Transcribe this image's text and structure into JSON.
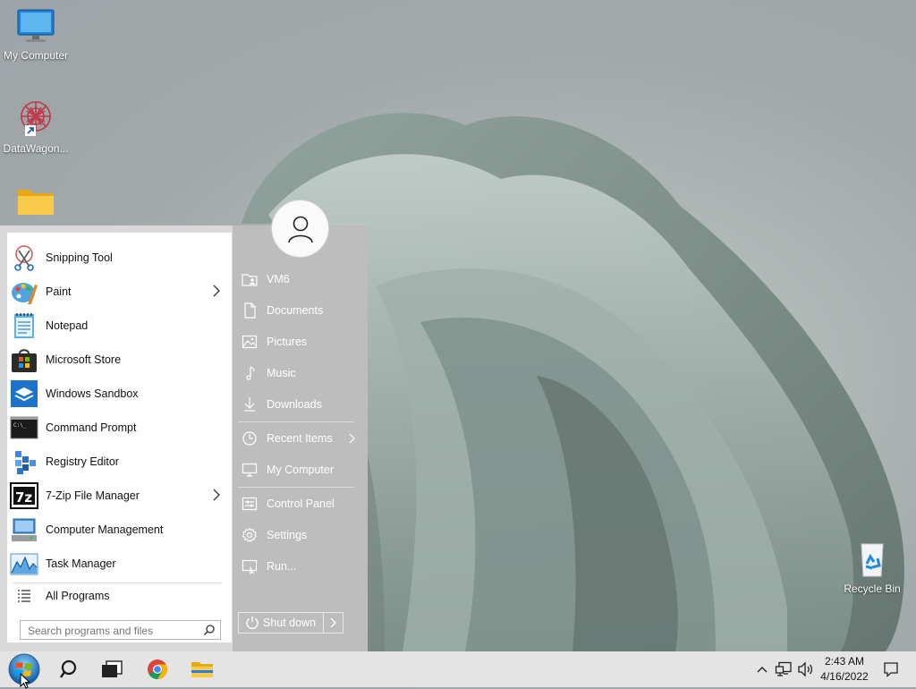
{
  "desktop": {
    "icons": [
      {
        "label": "My Computer",
        "icon": "monitor-icon"
      },
      {
        "label": "DataWagon...",
        "icon": "datawagon-icon"
      },
      {
        "label": "",
        "icon": "folder-icon"
      },
      {
        "label": "Recycle Bin",
        "icon": "recycle-bin-icon"
      }
    ]
  },
  "start_menu": {
    "programs": [
      {
        "label": "Snipping Tool",
        "icon": "snipping-tool-icon",
        "has_submenu": false
      },
      {
        "label": "Paint",
        "icon": "paint-icon",
        "has_submenu": true
      },
      {
        "label": "Notepad",
        "icon": "notepad-icon",
        "has_submenu": false
      },
      {
        "label": "Microsoft Store",
        "icon": "store-icon",
        "has_submenu": false
      },
      {
        "label": "Windows Sandbox",
        "icon": "sandbox-icon",
        "has_submenu": false
      },
      {
        "label": "Command Prompt",
        "icon": "cmd-icon",
        "has_submenu": false
      },
      {
        "label": "Registry Editor",
        "icon": "regedit-icon",
        "has_submenu": false
      },
      {
        "label": "7-Zip File Manager",
        "icon": "7zip-icon",
        "has_submenu": true
      },
      {
        "label": "Computer Management",
        "icon": "computer-management-icon",
        "has_submenu": false
      },
      {
        "label": "Task Manager",
        "icon": "task-manager-icon",
        "has_submenu": false
      }
    ],
    "all_programs": "All Programs",
    "search": {
      "placeholder": "Search programs and files",
      "value": ""
    },
    "places": [
      {
        "label": "VM6",
        "icon": "user-folder-icon"
      },
      {
        "label": "Documents",
        "icon": "document-icon"
      },
      {
        "label": "Pictures",
        "icon": "picture-icon"
      },
      {
        "label": "Music",
        "icon": "music-icon"
      },
      {
        "label": "Downloads",
        "icon": "download-icon"
      },
      {
        "label": "Recent Items",
        "icon": "clock-icon",
        "has_submenu": true
      },
      {
        "label": "My Computer",
        "icon": "computer-icon"
      },
      {
        "label": "Control Panel",
        "icon": "control-panel-icon"
      },
      {
        "label": "Settings",
        "icon": "gear-icon"
      },
      {
        "label": "Run...",
        "icon": "run-icon"
      }
    ],
    "shutdown_label": "Shut down"
  },
  "taskbar": {
    "pinned": [
      "start-orb-icon",
      "search-icon",
      "task-view-icon",
      "chrome-icon",
      "file-explorer-icon"
    ],
    "tray": [
      "chevron-up-icon",
      "network-icon",
      "volume-icon"
    ],
    "time": "2:43 AM",
    "date": "4/16/2022",
    "notification_icon": "notification-icon"
  },
  "colors": {
    "menu_left_bg": "#ffffff",
    "menu_right_bg": "#bdbdbd",
    "taskbar_bg": "#e4e4e4"
  }
}
